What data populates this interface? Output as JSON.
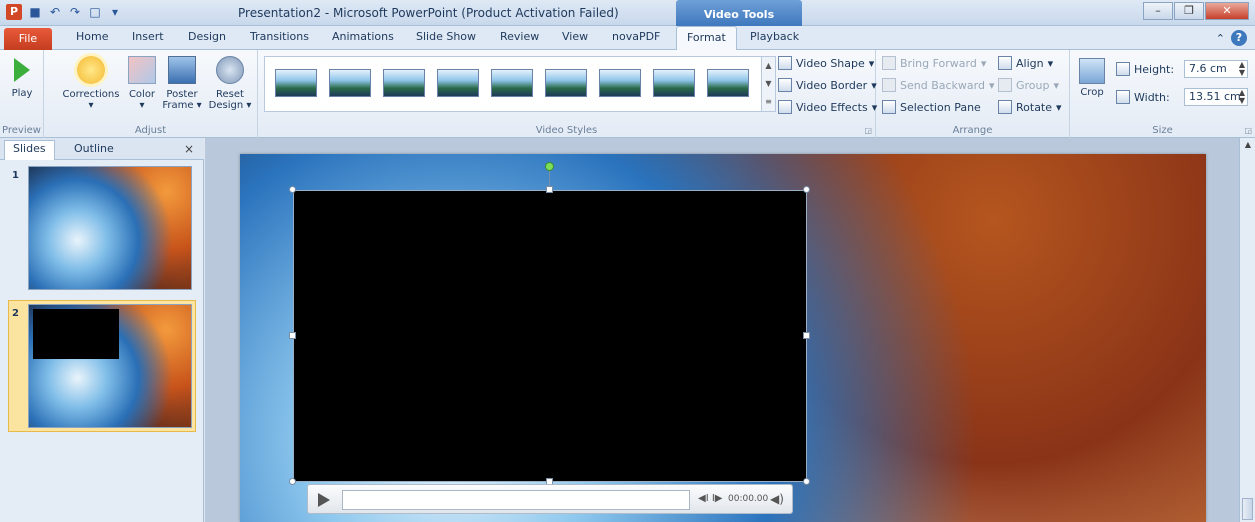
{
  "window": {
    "title": "Presentation2 - Microsoft PowerPoint (Product Activation Failed)",
    "context_tab": "Video Tools",
    "logo": "P"
  },
  "tabs": [
    "File",
    "Home",
    "Insert",
    "Design",
    "Transitions",
    "Animations",
    "Slide Show",
    "Review",
    "View",
    "novaPDF",
    "Format",
    "Playback"
  ],
  "active_tab": "Format",
  "ribbon": {
    "preview": {
      "play": "Play",
      "label": "Preview"
    },
    "adjust": {
      "corrections": "Corrections",
      "color": "Color",
      "poster_frame_1": "Poster",
      "poster_frame_2": "Frame",
      "reset_1": "Reset",
      "reset_2": "Design",
      "label": "Adjust"
    },
    "video_styles": {
      "label": "Video Styles",
      "shape": "Video Shape",
      "border": "Video Border",
      "effects": "Video Effects"
    },
    "arrange": {
      "bring_forward": "Bring Forward",
      "send_backward": "Send Backward",
      "selection_pane": "Selection Pane",
      "align": "Align",
      "group": "Group",
      "rotate": "Rotate",
      "label": "Arrange"
    },
    "size": {
      "crop": "Crop",
      "height_label": "Height:",
      "height_value": "7.6 cm",
      "width_label": "Width:",
      "width_value": "13.51 cm",
      "label": "Size"
    }
  },
  "left_pane": {
    "tabs": [
      "Slides",
      "Outline"
    ],
    "close": "×",
    "slides": [
      "1",
      "2"
    ]
  },
  "video_player": {
    "time": "00:00.00"
  }
}
